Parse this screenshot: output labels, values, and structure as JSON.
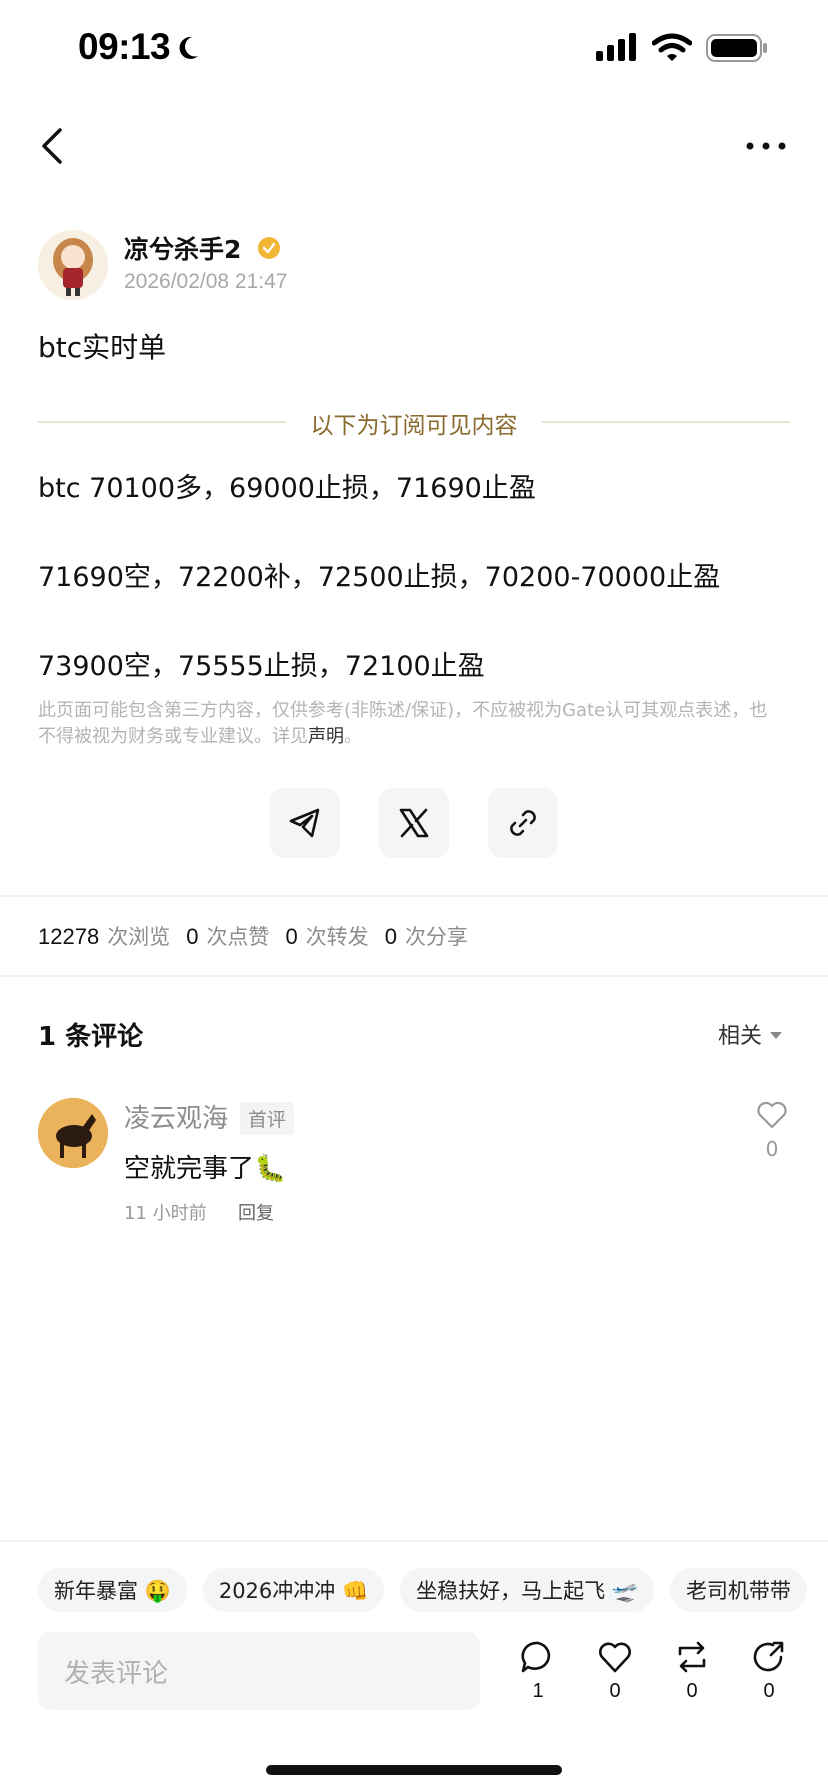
{
  "status_bar": {
    "time": "09:13"
  },
  "nav": {
    "back_icon": "chevron-left-icon",
    "more_icon": "ellipsis-icon"
  },
  "post": {
    "author": "凉兮杀手2",
    "timestamp": "2026/02/08 21:47",
    "title": "btc实时单",
    "subscription_label": "以下为订阅可见内容",
    "lines": [
      "btc 70100多，69000止损，71690止盈",
      "71690空，72200补，72500止损，70200-70000止盈",
      "73900空，75555止损，72100止盈"
    ],
    "disclaimer": "此页面可能包含第三方内容，仅供参考(非陈述/保证)，不应被视为Gate认可其观点表述，也不得被视为财务或专业建议。详见",
    "disclaimer_link": "声明",
    "disclaimer_end": "。"
  },
  "share": [
    {
      "icon": "telegram-icon"
    },
    {
      "icon": "x-icon"
    },
    {
      "icon": "link-icon"
    }
  ],
  "stats": {
    "views": "12278",
    "views_label": "次浏览",
    "likes": "0",
    "likes_label": "次点赞",
    "reposts": "0",
    "reposts_label": "次转发",
    "shares": "0",
    "shares_label": "次分享"
  },
  "comments": {
    "header": "1 条评论",
    "sort_label": "相关",
    "items": [
      {
        "user": "凌云观海",
        "badge": "首评",
        "text": "空就完事了🐛",
        "time": "11 小时前",
        "reply_label": "回复",
        "likes": "0"
      }
    ]
  },
  "tags": [
    {
      "label": "新年暴富 🤑"
    },
    {
      "label": "2026冲冲冲 👊"
    },
    {
      "label": "坐稳扶好，马上起飞 🛫"
    },
    {
      "label": "老司机带带"
    }
  ],
  "bottom_bar": {
    "placeholder": "发表评论",
    "comment_count": "1",
    "like_count": "0",
    "repost_count": "0",
    "share_count": "0"
  },
  "colors": {
    "accent_gold": "#8a6a2e",
    "verified": "#f1b635"
  }
}
